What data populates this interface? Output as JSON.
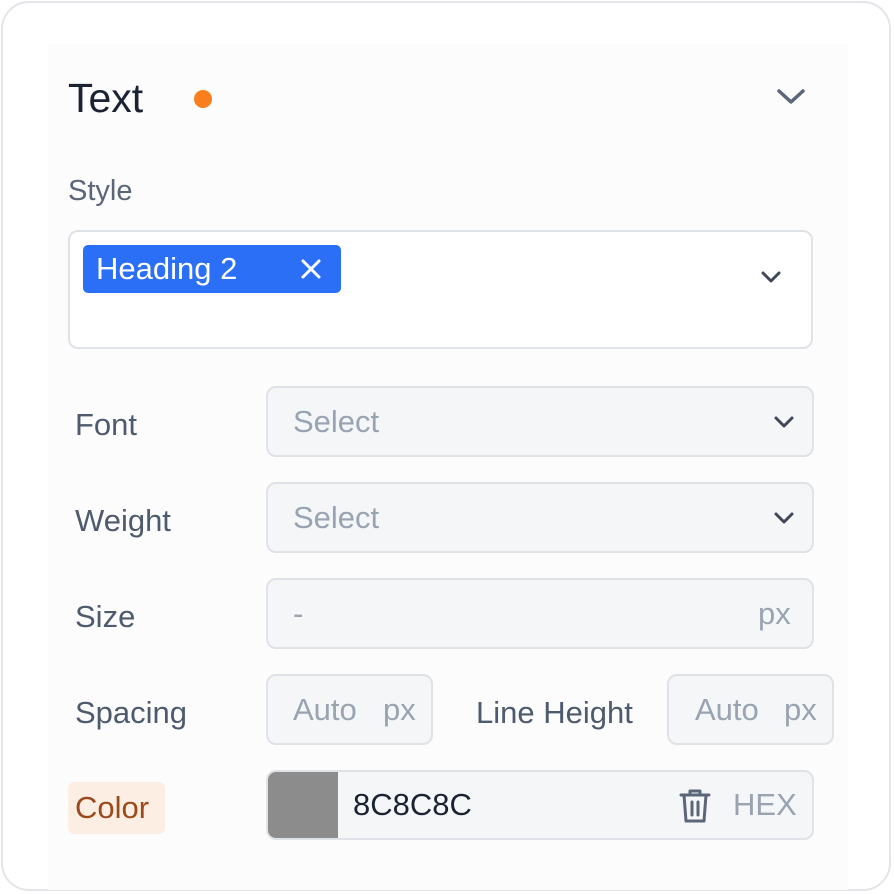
{
  "section": {
    "title": "Text",
    "modified_dot_color": "#f97f1e",
    "collapse_icon": "chevron-down-icon"
  },
  "style": {
    "label": "Style",
    "selected_tag": "Heading 2",
    "tag_color": "#2b6ff6",
    "remove_icon": "close-icon",
    "dropdown_icon": "chevron-down-icon"
  },
  "font": {
    "label": "Font",
    "placeholder": "Select"
  },
  "weight": {
    "label": "Weight",
    "placeholder": "Select"
  },
  "size": {
    "label": "Size",
    "value": "-",
    "unit": "px"
  },
  "spacing": {
    "label": "Spacing",
    "value": "Auto",
    "unit": "px"
  },
  "line_height": {
    "label": "Line Height",
    "value": "Auto",
    "unit": "px"
  },
  "color": {
    "label": "Color",
    "swatch": "#8c8c8c",
    "value": "8C8C8C",
    "delete_icon": "trash-icon",
    "mode": "HEX"
  }
}
